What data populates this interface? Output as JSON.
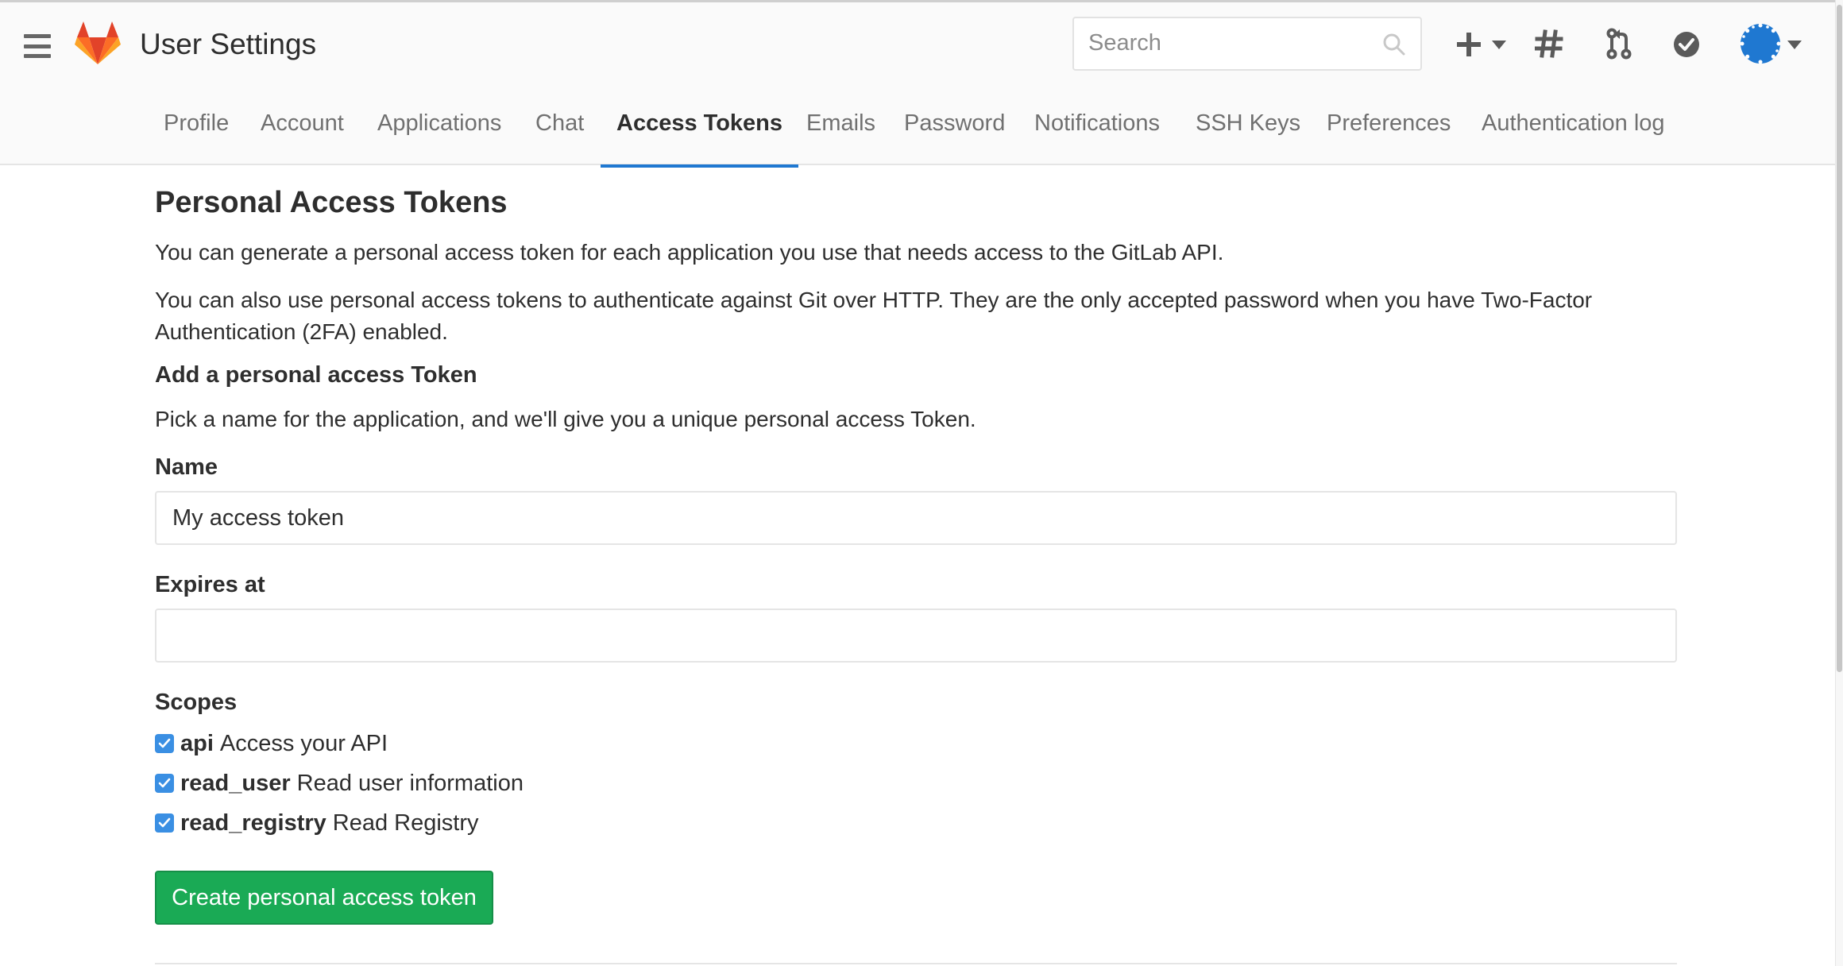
{
  "header": {
    "title": "User Settings",
    "search_placeholder": "Search"
  },
  "nav": {
    "tabs": [
      {
        "label": "Profile"
      },
      {
        "label": "Account"
      },
      {
        "label": "Applications"
      },
      {
        "label": "Chat"
      },
      {
        "label": "Access Tokens",
        "active": true
      },
      {
        "label": "Emails"
      },
      {
        "label": "Password"
      },
      {
        "label": "Notifications"
      },
      {
        "label": "SSH Keys"
      },
      {
        "label": "Preferences"
      },
      {
        "label": "Authentication log"
      }
    ]
  },
  "main": {
    "title": "Personal Access Tokens",
    "intro": "You can generate a personal access token for each application you use that needs access to the GitLab API.",
    "intro2": "You can also use personal access tokens to authenticate against Git over HTTP. They are the only accepted password when you have Two-Factor Authentication (2FA) enabled.",
    "add_heading": "Add a personal access Token",
    "add_desc": "Pick a name for the application, and we'll give you a unique personal access Token.",
    "name_label": "Name",
    "name_value": "My access token",
    "expires_label": "Expires at",
    "expires_value": "",
    "scopes_label": "Scopes",
    "scopes": [
      {
        "name": "api",
        "desc": "Access your API",
        "checked": true
      },
      {
        "name": "read_user",
        "desc": "Read user information",
        "checked": true
      },
      {
        "name": "read_registry",
        "desc": "Read Registry",
        "checked": true
      }
    ],
    "create_button": "Create personal access token"
  },
  "colors": {
    "accent": "#1f78d1",
    "create_button": "#1aaa55",
    "checkbox": "#3a8fe3"
  },
  "icons": [
    "menu-icon",
    "gitlab-logo",
    "search-icon",
    "plus-icon",
    "chevron-down-icon",
    "issues-hash-icon",
    "merge-request-icon",
    "todo-check-icon",
    "avatar"
  ]
}
